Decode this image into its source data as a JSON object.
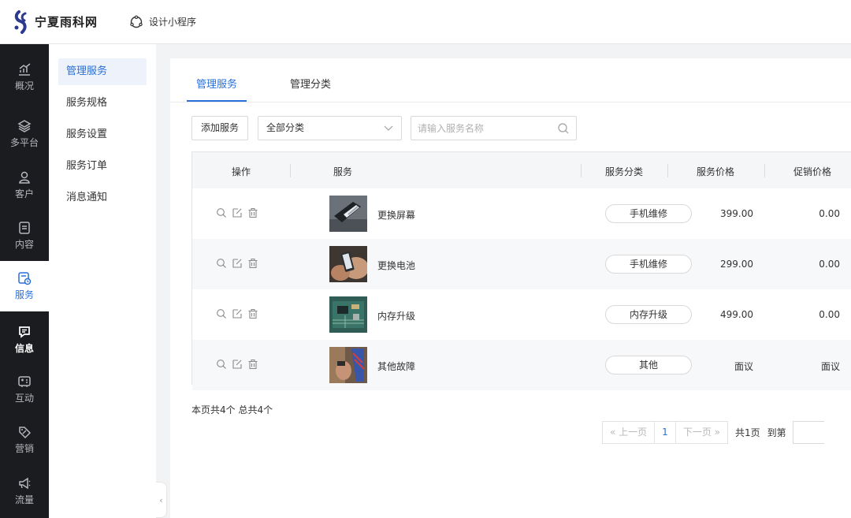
{
  "header": {
    "brand": "宁夏雨科网",
    "design_link": "设计小程序"
  },
  "nav": {
    "items": [
      {
        "label": "概况",
        "icon": "chart-icon"
      },
      {
        "label": "多平台",
        "icon": "layers-icon"
      },
      {
        "label": "客户",
        "icon": "user-icon"
      },
      {
        "label": "内容",
        "icon": "document-icon"
      },
      {
        "label": "服务",
        "icon": "service-icon",
        "active": true
      },
      {
        "label": "信息",
        "icon": "message-icon"
      },
      {
        "label": "互动",
        "icon": "interact-icon"
      },
      {
        "label": "营销",
        "icon": "tag-icon"
      },
      {
        "label": "流量",
        "icon": "megaphone-icon"
      }
    ]
  },
  "subnav": {
    "items": [
      "管理服务",
      "服务规格",
      "服务设置",
      "服务订单",
      "消息通知"
    ],
    "active_index": 0
  },
  "tabs": [
    "管理服务",
    "管理分类"
  ],
  "toolbar": {
    "add_label": "添加服务",
    "category_select": "全部分类",
    "search_placeholder": "请输入服务名称"
  },
  "table": {
    "headers": {
      "actions": "操作",
      "service": "服务",
      "category": "服务分类",
      "price": "服务价格",
      "promo": "促销价格"
    },
    "rows": [
      {
        "name": "更换屏幕",
        "category": "手机维修",
        "price": "399.00",
        "promo": "0.00"
      },
      {
        "name": "更换电池",
        "category": "手机维修",
        "price": "299.00",
        "promo": "0.00"
      },
      {
        "name": "内存升级",
        "category": "内存升级",
        "price": "499.00",
        "promo": "0.00"
      },
      {
        "name": "其他故障",
        "category": "其他",
        "price": "面议",
        "promo": "面议"
      }
    ]
  },
  "summary": {
    "page_count_text": "本页共4个",
    "total_text": "总共4个"
  },
  "pagination": {
    "prev": "« 上一页",
    "current_page": "1",
    "next": "下一页 »",
    "total_pages": "共1页",
    "goto": "到第"
  },
  "colors": {
    "accent": "#2a6fd8",
    "nav_bg": "#1b1c1f",
    "page_bg": "#f2f3f5"
  }
}
